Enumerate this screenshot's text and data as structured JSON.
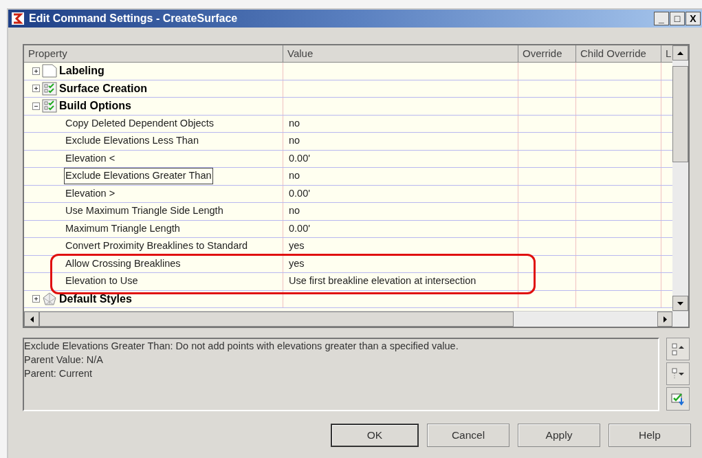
{
  "window": {
    "title": "Edit Command Settings - CreateSurface",
    "controls": [
      "_",
      "□",
      "X"
    ]
  },
  "grid": {
    "columns": [
      "Property",
      "Value",
      "Override",
      "Child Override",
      "L"
    ],
    "rows": [
      {
        "kind": "group",
        "label": "Labeling",
        "expanded": false
      },
      {
        "kind": "group",
        "label": "Surface Creation",
        "expanded": false
      },
      {
        "kind": "group",
        "label": "Build Options",
        "expanded": true
      },
      {
        "kind": "property",
        "label": "Copy Deleted Dependent Objects",
        "value": "no",
        "selected": false,
        "highlighted": false
      },
      {
        "kind": "property",
        "label": "Exclude Elevations Less Than",
        "value": "no",
        "selected": false,
        "highlighted": false
      },
      {
        "kind": "property",
        "label": "Elevation <",
        "value": "0.00'",
        "selected": false,
        "highlighted": false
      },
      {
        "kind": "property",
        "label": "Exclude Elevations Greater Than",
        "value": "no",
        "selected": true,
        "highlighted": false
      },
      {
        "kind": "property",
        "label": "Elevation >",
        "value": "0.00'",
        "selected": false,
        "highlighted": false
      },
      {
        "kind": "property",
        "label": "Use Maximum Triangle Side Length",
        "value": "no",
        "selected": false,
        "highlighted": false
      },
      {
        "kind": "property",
        "label": "Maximum Triangle Length",
        "value": "0.00'",
        "selected": false,
        "highlighted": false
      },
      {
        "kind": "property",
        "label": "Convert Proximity Breaklines to Standard",
        "value": "yes",
        "selected": false,
        "highlighted": false
      },
      {
        "kind": "property",
        "label": "Allow Crossing Breaklines",
        "value": "yes",
        "selected": false,
        "highlighted": true
      },
      {
        "kind": "property",
        "label": "Elevation to Use",
        "value": "Use first breakline elevation at intersection",
        "selected": false,
        "highlighted": true
      },
      {
        "kind": "group",
        "label": "Default Styles",
        "expanded": false
      }
    ]
  },
  "description": [
    "Exclude Elevations Greater Than: Do not add points with elevations greater than a specified value.",
    "Parent Value: N/A",
    "Parent: Current"
  ],
  "buttons": [
    "OK",
    "Cancel",
    "Apply",
    "Help"
  ]
}
